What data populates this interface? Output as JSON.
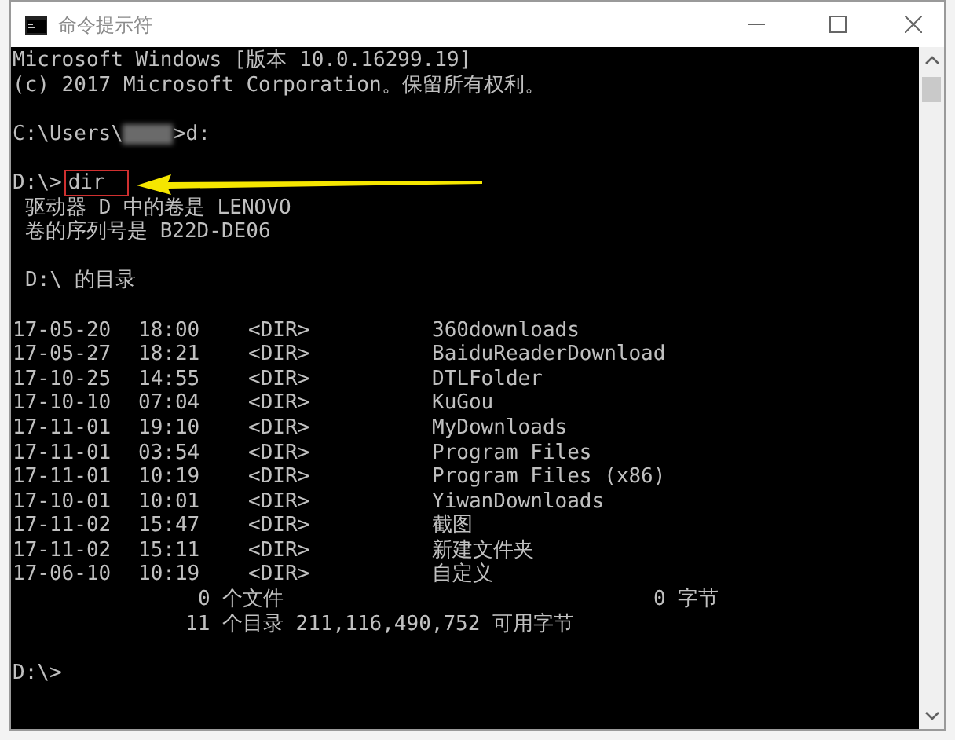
{
  "window": {
    "title": "命令提示符"
  },
  "console": {
    "banner": [
      "Microsoft Windows [版本 10.0.16299.19]",
      "(c) 2017 Microsoft Corporation。保留所有权利。"
    ],
    "user_prompt": {
      "before": "C:\\Users\\",
      "after": ">d:"
    },
    "dir_prompt": {
      "prompt": "D:\\>",
      "command": "dir",
      "highlighted": true
    },
    "volume_info": [
      "驱动器 D 中的卷是 LENOVO",
      "卷的序列号是 B22D-DE06"
    ],
    "directory_heading": "D:\\ 的目录",
    "entries": [
      {
        "date": "17-05-20",
        "time": "18:00",
        "type": "<DIR>",
        "name": "360downloads"
      },
      {
        "date": "17-05-27",
        "time": "18:21",
        "type": "<DIR>",
        "name": "BaiduReaderDownload"
      },
      {
        "date": "17-10-25",
        "time": "14:55",
        "type": "<DIR>",
        "name": "DTLFolder"
      },
      {
        "date": "17-10-10",
        "time": "07:04",
        "type": "<DIR>",
        "name": "KuGou"
      },
      {
        "date": "17-11-01",
        "time": "19:10",
        "type": "<DIR>",
        "name": "MyDownloads"
      },
      {
        "date": "17-11-01",
        "time": "03:54",
        "type": "<DIR>",
        "name": "Program Files"
      },
      {
        "date": "17-11-01",
        "time": "10:19",
        "type": "<DIR>",
        "name": "Program Files (x86)"
      },
      {
        "date": "17-10-01",
        "time": "10:01",
        "type": "<DIR>",
        "name": "YiwanDownloads"
      },
      {
        "date": "17-11-02",
        "time": "15:47",
        "type": "<DIR>",
        "name": "截图"
      },
      {
        "date": "17-11-02",
        "time": "15:11",
        "type": "<DIR>",
        "name": "新建文件夹"
      },
      {
        "date": "17-06-10",
        "time": "10:19",
        "type": "<DIR>",
        "name": "自定义"
      }
    ],
    "file_summary": {
      "count": "0 个文件",
      "size": "0 字节"
    },
    "dir_summary": "11 个目录 211,116,490,752 可用字节",
    "final_prompt": "D:\\>"
  }
}
